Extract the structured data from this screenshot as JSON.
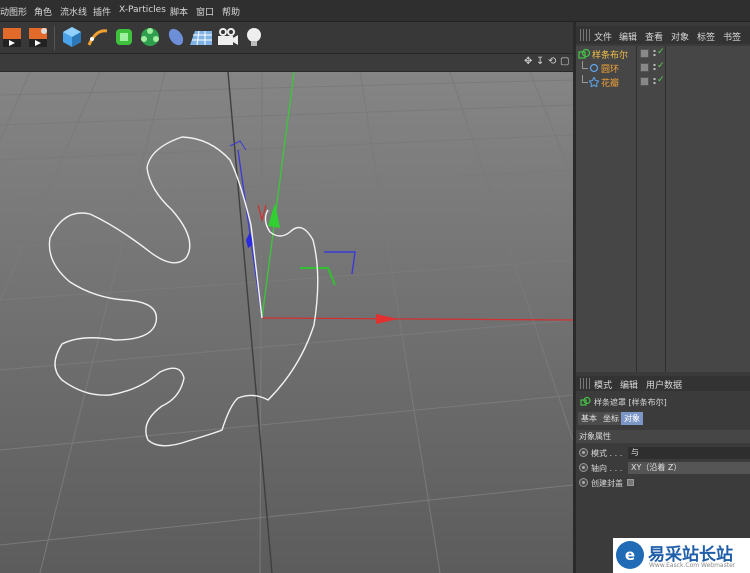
{
  "menubar": {
    "items": [
      "动图形",
      "角色",
      "流水线",
      "插件",
      "X-Particles",
      "脚本",
      "窗口",
      "帮助"
    ]
  },
  "toolbar": {
    "buttons": [
      "render-view-icon",
      "render-settings-icon",
      "cube-icon",
      "pen-spline-icon",
      "subdivision-icon",
      "array-icon",
      "deformer-icon",
      "floor-icon",
      "camera-icon",
      "light-icon"
    ]
  },
  "object_manager": {
    "menu": [
      "文件",
      "编辑",
      "查看",
      "对象",
      "标签",
      "书签"
    ],
    "objects": [
      {
        "name": "样条布尔",
        "level": 0,
        "color": "#f2c04a",
        "icon": "spline-mask-icon"
      },
      {
        "name": "圆环",
        "level": 1,
        "color": "#f2a33a",
        "icon": "circle-icon"
      },
      {
        "name": "花瓣",
        "level": 1,
        "color": "#f2a33a",
        "icon": "flower-icon"
      }
    ]
  },
  "attribute_manager": {
    "menu": [
      "模式",
      "编辑",
      "用户数据"
    ],
    "title": "样条遮罩 [样条布尔]",
    "tabs": [
      "基本",
      "坐标",
      "对象"
    ],
    "active_tab": "对象",
    "section": "对象属性",
    "fields": [
      {
        "label": "模式 . . .",
        "value": "与"
      },
      {
        "label": "轴向 . . .",
        "value": "XY（沿着 Z）"
      },
      {
        "label": "创建封盖",
        "checkbox": false
      }
    ]
  },
  "watermark": {
    "text": "易采站长站",
    "sub": "Www.Easck.Com Webmaster"
  }
}
